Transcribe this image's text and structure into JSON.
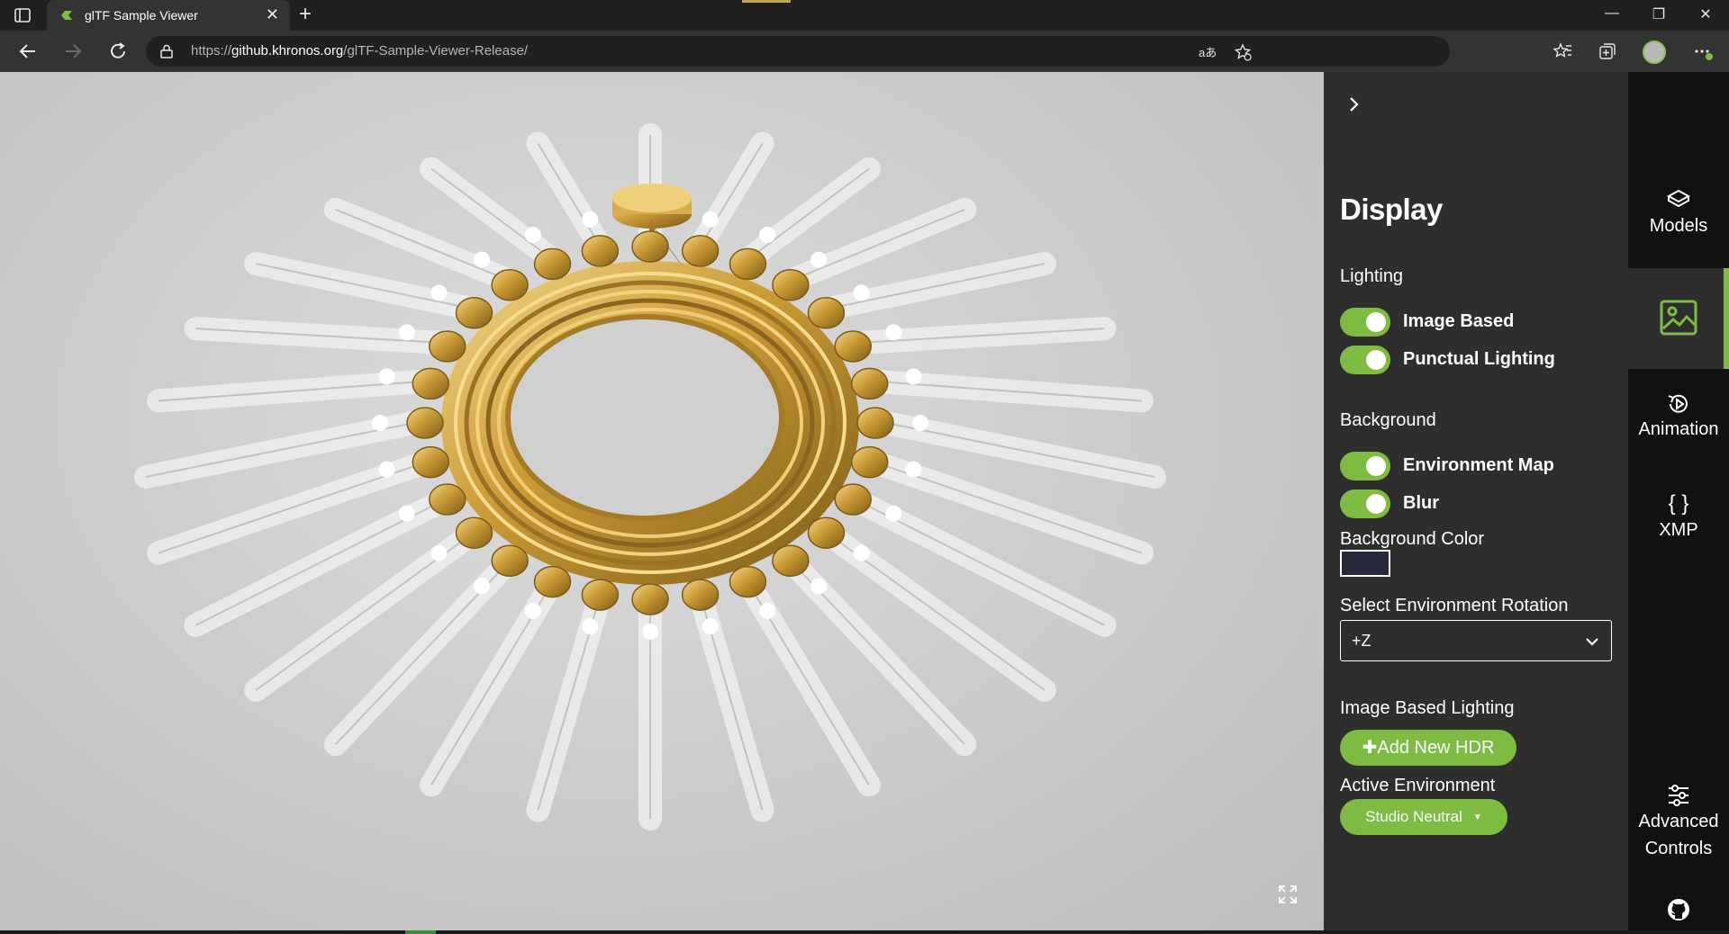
{
  "browser": {
    "tab_title": "glTF Sample Viewer",
    "tab_close_icon": "close-icon",
    "new_tab_icon": "plus-icon",
    "url_prefix": "https://",
    "url_host": "github.khronos.org",
    "url_path": "/glTF-Sample-Viewer-Release/",
    "window_controls": [
      "minimize-icon",
      "restore-icon",
      "close-icon"
    ]
  },
  "panel": {
    "title": "Display",
    "lighting": {
      "label": "Lighting",
      "image_based": {
        "label": "Image Based",
        "enabled": true
      },
      "punctual": {
        "label": "Punctual Lighting",
        "enabled": true
      }
    },
    "background": {
      "label": "Background",
      "environment_map": {
        "label": "Environment Map",
        "enabled": true
      },
      "blur": {
        "label": "Blur",
        "enabled": true
      },
      "color_label": "Background Color",
      "color_value": "#25293a"
    },
    "rotation": {
      "label": "Select Environment Rotation",
      "value": "+Z"
    },
    "ibl": {
      "label": "Image Based Lighting",
      "add_button": "✚Add New HDR",
      "active_label": "Active Environment",
      "active_value": "Studio Neutral"
    }
  },
  "sidebar": {
    "items": [
      {
        "label": "Models",
        "icon": "cube-icon"
      },
      {
        "label": "",
        "icon": "image-icon",
        "active": true
      },
      {
        "label": "Animation",
        "icon": "play-rotate-icon"
      },
      {
        "label": "XMP",
        "icon": "braces-icon"
      },
      {
        "label": "Advanced Controls",
        "icon": "sliders-icon"
      },
      {
        "label": "",
        "icon": "github-icon"
      }
    ]
  },
  "colors": {
    "accent": "#7dbb42",
    "panel_bg": "#2e2e2e",
    "sidebar_bg": "#111111",
    "gold": "#d4a640"
  }
}
